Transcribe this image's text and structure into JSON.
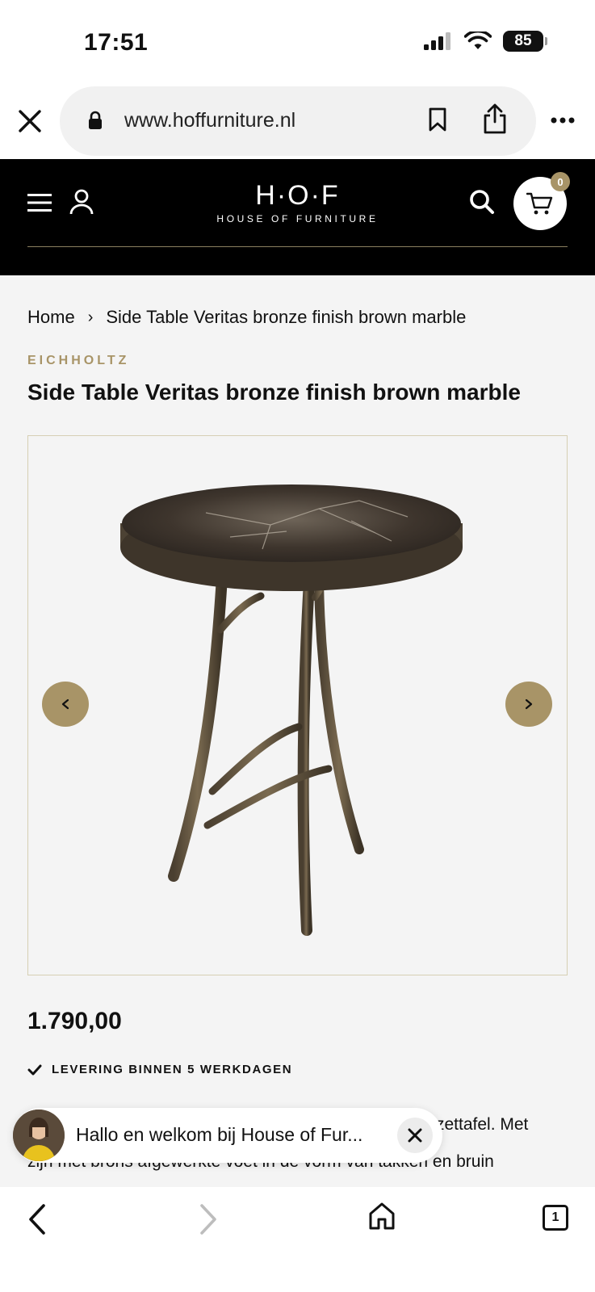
{
  "status_bar": {
    "time": "17:51",
    "battery": "85"
  },
  "browser": {
    "url": "www.hoffurniture.nl"
  },
  "header": {
    "logo_main": "H·O·F",
    "logo_sub": "HOUSE OF FURNITURE",
    "cart_count": "0"
  },
  "breadcrumb": {
    "home": "Home",
    "current": "Side Table Veritas bronze finish brown marble"
  },
  "product": {
    "brand": "EICHHOLTZ",
    "title": "Side Table Veritas bronze finish brown marble",
    "price": "1.790,00",
    "delivery": "LEVERING BINNEN 5 WERKDAGEN",
    "description_line1_visible": "zettafel. Met",
    "description_line2_visible": "zijn met brons afgewerkte voet in de vorm van takken en bruin"
  },
  "chat": {
    "message": "Hallo en welkom bij House of Fur..."
  },
  "toolbar": {
    "tab_count": "1"
  },
  "colors": {
    "accent": "#a89467",
    "header_bg": "#000000",
    "page_bg": "#f4f4f4"
  }
}
